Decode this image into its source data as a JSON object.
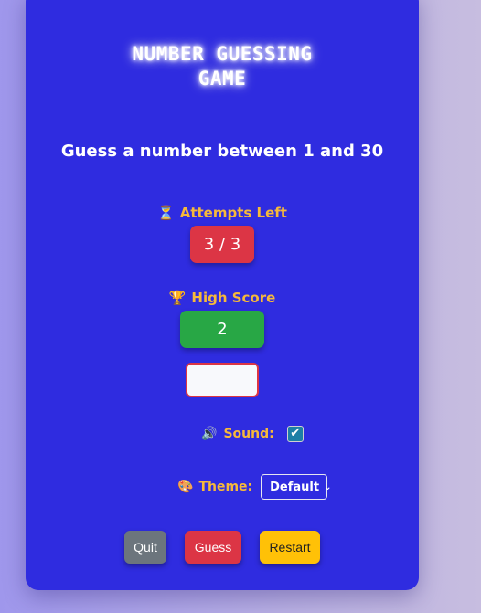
{
  "game": {
    "title": "NUMBER GUESSING\nGAME",
    "subtitle": "Guess a number between 1 and 30"
  },
  "attempts": {
    "icon": "⏳",
    "label": "Attempts Left",
    "value": "3 / 3"
  },
  "high_score": {
    "icon": "🏆",
    "label": "High Score",
    "value": "2"
  },
  "guess_input": {
    "value": ""
  },
  "sound": {
    "icon": "🔊",
    "label": "Sound:",
    "checked": "✔"
  },
  "theme": {
    "icon": "🎨",
    "label": "Theme:",
    "selected": "Default",
    "chevron": "⌄"
  },
  "buttons": {
    "quit": "Quit",
    "guess": "Guess",
    "restart": "Restart"
  },
  "colors": {
    "card_bg": "#2f2ce0",
    "accent": "#f6b93b",
    "danger": "#dc3545",
    "success": "#28a745",
    "warning": "#ffc107",
    "secondary": "#6c757d"
  }
}
